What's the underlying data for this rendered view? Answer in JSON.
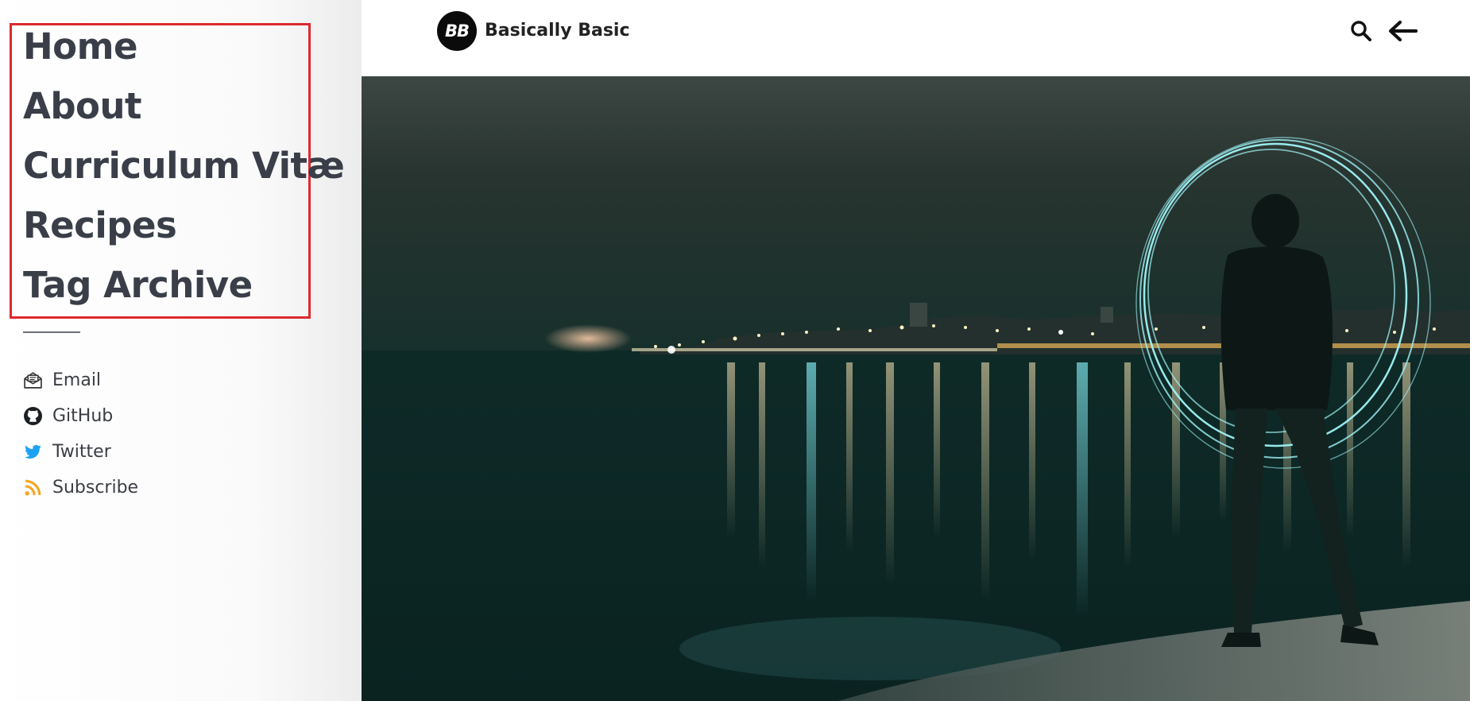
{
  "sidebar": {
    "nav_items": [
      {
        "label": "Home"
      },
      {
        "label": "About"
      },
      {
        "label": "Curriculum Vitæ"
      },
      {
        "label": "Recipes"
      },
      {
        "label": "Tag Archive"
      }
    ],
    "social_links": [
      {
        "label": "Email",
        "icon": "envelope-icon",
        "color": "#333333"
      },
      {
        "label": "GitHub",
        "icon": "github-icon",
        "color": "#1b1f23"
      },
      {
        "label": "Twitter",
        "icon": "twitter-icon",
        "color": "#1da1f2"
      },
      {
        "label": "Subscribe",
        "icon": "rss-icon",
        "color": "#f5a623"
      }
    ]
  },
  "header": {
    "logo_text": "BB",
    "site_title": "Basically Basic",
    "search_icon": "search-icon",
    "back_icon": "arrow-left-icon"
  },
  "hero": {
    "description": "",
    "sky_color": "#2a3a36",
    "water_color": "#0f2a28",
    "light_ring_color": "#8fe9f0"
  },
  "colors": {
    "highlight_border": "#dc2a2e",
    "nav_text": "#393e48"
  }
}
